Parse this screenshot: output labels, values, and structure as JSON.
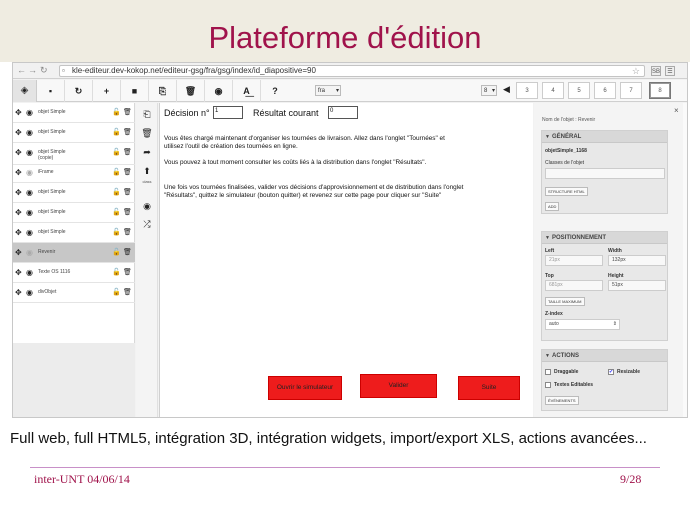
{
  "slide": {
    "title": "Plateforme d'édition",
    "caption": "Full web, full HTML5, intégration 3D, intégration widgets, import/export XLS, actions avancées...",
    "footer_left": "inter-UNT 04/06/14",
    "footer_right": "9/28",
    "title_color": "#a0134b"
  },
  "browser": {
    "url": "kle-editeur.dev-kokop.net/editeur-gsg/fra/gsg/index/id_diapositive=90",
    "extensions": [
      "SB",
      "☰"
    ]
  },
  "toolbar": {
    "icons": [
      "layers-icon",
      "save-icon",
      "refresh-icon",
      "add-icon",
      "folder-icon",
      "copy-icon",
      "delete-icon",
      "preview-icon",
      "translate-icon",
      "help-icon"
    ],
    "lang_select": "fra",
    "slide_select": "8",
    "pages": [
      "3",
      "4",
      "5",
      "6",
      "7",
      "8"
    ],
    "active_page": "8"
  },
  "layers": [
    {
      "label": "objet Simple",
      "label2": "",
      "visible": true,
      "selected": false
    },
    {
      "label": "objet Simple",
      "label2": "",
      "visible": true,
      "selected": false
    },
    {
      "label": "objet Simple",
      "label2": "(copie)",
      "visible": true,
      "selected": false
    },
    {
      "label": "iFrame",
      "label2": "",
      "visible": false,
      "selected": false
    },
    {
      "label": "objet Simple",
      "label2": "",
      "visible": true,
      "selected": false
    },
    {
      "label": "objet Simple",
      "label2": "",
      "visible": true,
      "selected": false
    },
    {
      "label": "objet Simple",
      "label2": "",
      "visible": true,
      "selected": false
    },
    {
      "label": "Revenir",
      "label2": "",
      "visible": false,
      "selected": true
    },
    {
      "label": "Texte OS 1116",
      "label2": "",
      "visible": true,
      "selected": false
    },
    {
      "label": "divObjet",
      "label2": "",
      "visible": true,
      "selected": false
    }
  ],
  "toolstrip": {
    "class_label": "class"
  },
  "canvas": {
    "decision_label": "Décision n°",
    "decision_value": "1",
    "result_label": "Résultat courant",
    "result_value": "0",
    "paragraphs": [
      "Vous êtes chargé maintenant d'organiser les tournées de livraison. Allez dans l'onglet \"Tournées\" et utilisez l'outil de création des tournées en ligne.",
      "Vous pouvez à tout moment consulter les coûts liés à la distribution dans l'onglet \"Résultats\".",
      "Une fois vos tournées finalisées, valider vos décisions d'approvisionnement et de distribution dans l'onglet \"Résultats\", quittez le simulateur (bouton quitter) et revenez sur cette page pour cliquer sur \"Suite\""
    ],
    "buttons": {
      "open_sim": "Ouvrir le simulateur",
      "validate": "Valider",
      "next": "Suite"
    },
    "button_color": "#ee1c1c"
  },
  "props": {
    "object_name": "Nom de l'objet : Revenir",
    "general": {
      "title": "GÉNÉRAL",
      "id_value": "objetSimple_1168",
      "classes_label": "Classes de l'objet",
      "structure_btn": "STRUCTURE HTML",
      "add_btn": "ADD"
    },
    "position": {
      "title": "POSITIONNEMENT",
      "left_label": "Left",
      "left_value": "21px",
      "width_label": "Width",
      "width_value": "132px",
      "top_label": "Top",
      "top_value": "681px",
      "height_label": "Height",
      "height_value": "51px",
      "max_size_btn": "TAILLE MAXIMUM",
      "zindex_label": "Z-index",
      "zindex_value": "auto"
    },
    "actions": {
      "title": "ACTIONS",
      "draggable_label": "Draggable",
      "draggable": false,
      "resizable_label": "Resizable",
      "resizable": true,
      "editable_label": "Textes Editables",
      "editable": false,
      "events_btn": "ÉVÉNEMENTS"
    }
  }
}
